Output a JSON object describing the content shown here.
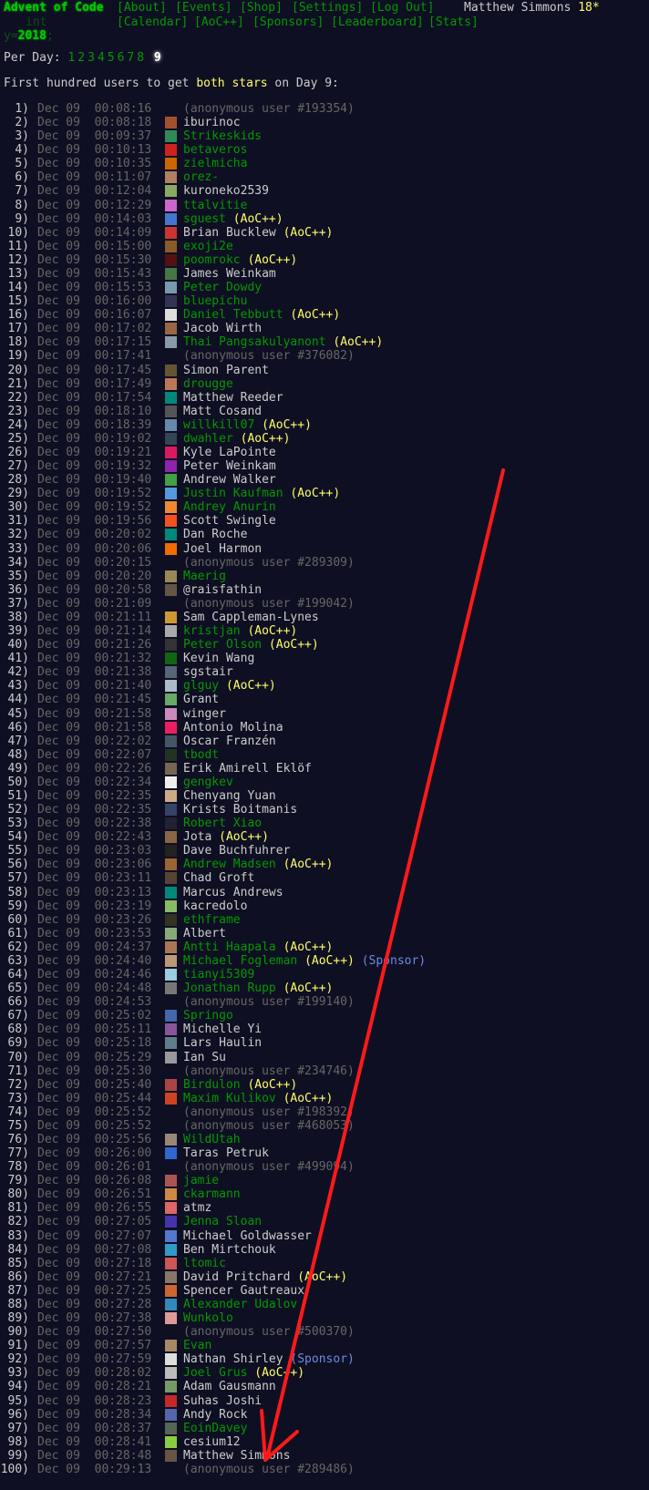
{
  "header": {
    "title": "Advent of Code",
    "year_prefix": "int y=",
    "year_value": "2018",
    "year_suffix": ";",
    "nav": [
      "[About]",
      "[Events]",
      "[Shop]",
      "[Settings]",
      "[Log Out]"
    ],
    "nav2": [
      "[Calendar]",
      "[AoC++]",
      "[Sponsors]",
      "[Leaderboard]",
      "[Stats]"
    ],
    "user": "Matthew Simmons",
    "stars": "18*"
  },
  "per_day": {
    "label": "Per Day:",
    "days": [
      "1",
      "2",
      "3",
      "4",
      "5",
      "6",
      "7",
      "8"
    ],
    "current": "9"
  },
  "intro": {
    "before": "First hundred users to get ",
    "highlight": "both stars",
    "after": " on Day 9:"
  },
  "entries": [
    {
      "rank": "1)",
      "time": "Dec 09  00:08:16",
      "name": "(anonymous user #193354)",
      "style": "anon",
      "avatar": "none"
    },
    {
      "rank": "2)",
      "time": "Dec 09  00:08:18",
      "name": "iburinoc",
      "style": "plain",
      "avatar": "#a0522d"
    },
    {
      "rank": "3)",
      "time": "Dec 09  00:09:37",
      "name": "Strikeskids",
      "style": "linked",
      "avatar": "#2e8b57"
    },
    {
      "rank": "4)",
      "time": "Dec 09  00:10:13",
      "name": "betaveros",
      "style": "linked",
      "avatar": "#cc2222"
    },
    {
      "rank": "5)",
      "time": "Dec 09  00:10:35",
      "name": "zielmicha",
      "style": "linked",
      "avatar": "#cc6600"
    },
    {
      "rank": "6)",
      "time": "Dec 09  00:11:07",
      "name": "orez-",
      "style": "linked",
      "avatar": "#b08060"
    },
    {
      "rank": "7)",
      "time": "Dec 09  00:12:04",
      "name": "kuroneko2539",
      "style": "plain",
      "avatar": "#88aa66"
    },
    {
      "rank": "8)",
      "time": "Dec 09  00:12:29",
      "name": "ttalvitie",
      "style": "linked",
      "avatar": "#cc66cc"
    },
    {
      "rank": "9)",
      "time": "Dec 09  00:14:03",
      "name": "sguest",
      "style": "linked",
      "aoc": "(AoC++)",
      "avatar": "#4477cc"
    },
    {
      "rank": "10)",
      "time": "Dec 09  00:14:09",
      "name": "Brian Bucklew",
      "style": "plain",
      "aoc": "(AoC++)",
      "avatar": "#cc3333"
    },
    {
      "rank": "11)",
      "time": "Dec 09  00:15:00",
      "name": "exoji2e",
      "style": "linked",
      "avatar": "#8b5a2b"
    },
    {
      "rank": "12)",
      "time": "Dec 09  00:15:30",
      "name": "poomrokc",
      "style": "linked",
      "aoc": "(AoC++)",
      "avatar": "#551111"
    },
    {
      "rank": "13)",
      "time": "Dec 09  00:15:43",
      "name": "James Weinkam",
      "style": "plain",
      "avatar": "#447744"
    },
    {
      "rank": "14)",
      "time": "Dec 09  00:15:53",
      "name": "Peter Dowdy",
      "style": "linked",
      "avatar": "#7799aa"
    },
    {
      "rank": "15)",
      "time": "Dec 09  00:16:00",
      "name": "bluepichu",
      "style": "linked",
      "avatar": "#333355"
    },
    {
      "rank": "16)",
      "time": "Dec 09  00:16:07",
      "name": "Daniel Tebbutt",
      "style": "linked",
      "aoc": "(AoC++)",
      "avatar": "#dddddd"
    },
    {
      "rank": "17)",
      "time": "Dec 09  00:17:02",
      "name": "Jacob Wirth",
      "style": "plain",
      "avatar": "#996644"
    },
    {
      "rank": "18)",
      "time": "Dec 09  00:17:15",
      "name": "Thai Pangsakulyanont",
      "style": "linked",
      "aoc": "(AoC++)",
      "avatar": "#8899aa"
    },
    {
      "rank": "19)",
      "time": "Dec 09  00:17:41",
      "name": "(anonymous user #376082)",
      "style": "anon",
      "avatar": "none"
    },
    {
      "rank": "20)",
      "time": "Dec 09  00:17:45",
      "name": "Simon Parent",
      "style": "plain",
      "avatar": "#665533"
    },
    {
      "rank": "21)",
      "time": "Dec 09  00:17:49",
      "name": "drougge",
      "style": "linked",
      "avatar": "#bb7755"
    },
    {
      "rank": "22)",
      "time": "Dec 09  00:17:54",
      "name": "Matthew Reeder",
      "style": "plain",
      "avatar": "#00897b"
    },
    {
      "rank": "23)",
      "time": "Dec 09  00:18:10",
      "name": "Matt Cosand",
      "style": "plain",
      "avatar": "#555555"
    },
    {
      "rank": "24)",
      "time": "Dec 09  00:18:39",
      "name": "willkill07",
      "style": "linked",
      "aoc": "(AoC++)",
      "avatar": "#6688aa"
    },
    {
      "rank": "25)",
      "time": "Dec 09  00:19:02",
      "name": "dwahler",
      "style": "linked",
      "aoc": "(AoC++)",
      "avatar": "#334455"
    },
    {
      "rank": "26)",
      "time": "Dec 09  00:19:21",
      "name": "Kyle LaPointe",
      "style": "plain",
      "avatar": "#d81b60"
    },
    {
      "rank": "27)",
      "time": "Dec 09  00:19:32",
      "name": "Peter Weinkam",
      "style": "plain",
      "avatar": "#8e24aa"
    },
    {
      "rank": "28)",
      "time": "Dec 09  00:19:40",
      "name": "Andrew Walker",
      "style": "plain",
      "avatar": "#43a047"
    },
    {
      "rank": "29)",
      "time": "Dec 09  00:19:52",
      "name": "Justin Kaufman",
      "style": "linked",
      "aoc": "(AoC++)",
      "avatar": "#5599dd"
    },
    {
      "rank": "30)",
      "time": "Dec 09  00:19:52",
      "name": "Andrey Anurin",
      "style": "linked",
      "avatar": "#ee8833"
    },
    {
      "rank": "31)",
      "time": "Dec 09  00:19:56",
      "name": "Scott Swingle",
      "style": "plain",
      "avatar": "#f4511e"
    },
    {
      "rank": "32)",
      "time": "Dec 09  00:20:02",
      "name": "Dan Roche",
      "style": "plain",
      "avatar": "#00897b"
    },
    {
      "rank": "33)",
      "time": "Dec 09  00:20:06",
      "name": "Joel Harmon",
      "style": "plain",
      "avatar": "#ef6c00"
    },
    {
      "rank": "34)",
      "time": "Dec 09  00:20:15",
      "name": "(anonymous user #289309)",
      "style": "anon",
      "avatar": "none"
    },
    {
      "rank": "35)",
      "time": "Dec 09  00:20:20",
      "name": "Maerig",
      "style": "linked",
      "avatar": "#998855"
    },
    {
      "rank": "36)",
      "time": "Dec 09  00:20:58",
      "name": "@raisfathin",
      "style": "plain",
      "avatar": "#665544"
    },
    {
      "rank": "37)",
      "time": "Dec 09  00:21:09",
      "name": "(anonymous user #199042)",
      "style": "anon",
      "avatar": "none"
    },
    {
      "rank": "38)",
      "time": "Dec 09  00:21:11",
      "name": "Sam Cappleman-Lynes",
      "style": "plain",
      "avatar": "#cc9933"
    },
    {
      "rank": "39)",
      "time": "Dec 09  00:21:14",
      "name": "kristjan",
      "style": "linked",
      "aoc": "(AoC++)",
      "avatar": "#aaaaaa"
    },
    {
      "rank": "40)",
      "time": "Dec 09  00:21:26",
      "name": "Peter Olson",
      "style": "linked",
      "aoc": "(AoC++)",
      "avatar": "#333333"
    },
    {
      "rank": "41)",
      "time": "Dec 09  00:21:32",
      "name": "Kevin Wang",
      "style": "plain",
      "avatar": "#116611"
    },
    {
      "rank": "42)",
      "time": "Dec 09  00:21:38",
      "name": "sgstair",
      "style": "plain",
      "avatar": "#556677"
    },
    {
      "rank": "43)",
      "time": "Dec 09  00:21:40",
      "name": "glguy",
      "style": "linked",
      "aoc": "(AoC++)",
      "avatar": "#aabbcc"
    },
    {
      "rank": "44)",
      "time": "Dec 09  00:21:45",
      "name": "Grant",
      "style": "plain",
      "avatar": "#66aa66"
    },
    {
      "rank": "45)",
      "time": "Dec 09  00:21:58",
      "name": "winger",
      "style": "plain",
      "avatar": "#cc88bb"
    },
    {
      "rank": "46)",
      "time": "Dec 09  00:21:58",
      "name": "Antonio Molina",
      "style": "plain",
      "avatar": "#e91e63"
    },
    {
      "rank": "47)",
      "time": "Dec 09  00:22:02",
      "name": "Oscar Franzén",
      "style": "plain",
      "avatar": "#445566"
    },
    {
      "rank": "48)",
      "time": "Dec 09  00:22:07",
      "name": "tbodt",
      "style": "linked",
      "avatar": "#223322"
    },
    {
      "rank": "49)",
      "time": "Dec 09  00:22:26",
      "name": "Erik Amirell Eklöf",
      "style": "plain",
      "avatar": "#776655"
    },
    {
      "rank": "50)",
      "time": "Dec 09  00:22:34",
      "name": "gengkev",
      "style": "linked",
      "avatar": "#eeeeee"
    },
    {
      "rank": "51)",
      "time": "Dec 09  00:22:35",
      "name": "Chenyang Yuan",
      "style": "plain",
      "avatar": "#ccaa88"
    },
    {
      "rank": "52)",
      "time": "Dec 09  00:22:35",
      "name": "Krists Boitmanis",
      "style": "plain",
      "avatar": "#334466"
    },
    {
      "rank": "53)",
      "time": "Dec 09  00:22:38",
      "name": "Robert Xiao",
      "style": "linked",
      "avatar": "#222233"
    },
    {
      "rank": "54)",
      "time": "Dec 09  00:22:43",
      "name": "Jota",
      "style": "plain",
      "aoc": "(AoC++)",
      "avatar": "#886644"
    },
    {
      "rank": "55)",
      "time": "Dec 09  00:23:03",
      "name": "Dave Buchfuhrer",
      "style": "plain",
      "avatar": "#222222"
    },
    {
      "rank": "56)",
      "time": "Dec 09  00:23:06",
      "name": "Andrew Madsen",
      "style": "linked",
      "aoc": "(AoC++)",
      "avatar": "#996633"
    },
    {
      "rank": "57)",
      "time": "Dec 09  00:23:11",
      "name": "Chad Groft",
      "style": "plain",
      "avatar": "#554433"
    },
    {
      "rank": "58)",
      "time": "Dec 09  00:23:13",
      "name": "Marcus Andrews",
      "style": "plain",
      "avatar": "#00897b"
    },
    {
      "rank": "59)",
      "time": "Dec 09  00:23:19",
      "name": "kacredolo",
      "style": "plain",
      "avatar": "#88bb66"
    },
    {
      "rank": "60)",
      "time": "Dec 09  00:23:26",
      "name": "ethframe",
      "style": "linked",
      "avatar": "#333322"
    },
    {
      "rank": "61)",
      "time": "Dec 09  00:23:53",
      "name": "Albert",
      "style": "plain",
      "avatar": "#88aa77"
    },
    {
      "rank": "62)",
      "time": "Dec 09  00:24:37",
      "name": "Antti Haapala",
      "style": "linked",
      "aoc": "(AoC++)",
      "avatar": "#aa7755"
    },
    {
      "rank": "63)",
      "time": "Dec 09  00:24:40",
      "name": "Michael Fogleman",
      "style": "linked",
      "aoc": "(AoC++)",
      "sponsor": "(Sponsor)",
      "avatar": "#bb9977"
    },
    {
      "rank": "64)",
      "time": "Dec 09  00:24:46",
      "name": "tianyi5309",
      "style": "linked",
      "avatar": "#99ccdd"
    },
    {
      "rank": "65)",
      "time": "Dec 09  00:24:48",
      "name": "Jonathan Rupp",
      "style": "linked",
      "aoc": "(AoC++)",
      "avatar": "#777777"
    },
    {
      "rank": "66)",
      "time": "Dec 09  00:24:53",
      "name": "(anonymous user #199140)",
      "style": "anon",
      "avatar": "none"
    },
    {
      "rank": "67)",
      "time": "Dec 09  00:25:02",
      "name": "Springo",
      "style": "linked",
      "avatar": "#4466aa"
    },
    {
      "rank": "68)",
      "time": "Dec 09  00:25:11",
      "name": "Michelle Yi",
      "style": "plain",
      "avatar": "#885599"
    },
    {
      "rank": "69)",
      "time": "Dec 09  00:25:18",
      "name": "Lars Haulin",
      "style": "plain",
      "avatar": "#607d8b"
    },
    {
      "rank": "70)",
      "time": "Dec 09  00:25:29",
      "name": "Ian Su",
      "style": "plain",
      "avatar": "#999999"
    },
    {
      "rank": "71)",
      "time": "Dec 09  00:25:30",
      "name": "(anonymous user #234746)",
      "style": "anon",
      "avatar": "none"
    },
    {
      "rank": "72)",
      "time": "Dec 09  00:25:40",
      "name": "Birdulon",
      "style": "linked",
      "aoc": "(AoC++)",
      "avatar": "#aa4444"
    },
    {
      "rank": "73)",
      "time": "Dec 09  00:25:44",
      "name": "Maxim Kulikov",
      "style": "linked",
      "aoc": "(AoC++)",
      "avatar": "#cc4422"
    },
    {
      "rank": "74)",
      "time": "Dec 09  00:25:52",
      "name": "(anonymous user #198392)",
      "style": "anon",
      "avatar": "none"
    },
    {
      "rank": "75)",
      "time": "Dec 09  00:25:52",
      "name": "(anonymous user #468053)",
      "style": "anon",
      "avatar": "none"
    },
    {
      "rank": "76)",
      "time": "Dec 09  00:25:56",
      "name": "WildUtah",
      "style": "linked",
      "avatar": "#998877"
    },
    {
      "rank": "77)",
      "time": "Dec 09  00:26:00",
      "name": "Taras Petruk",
      "style": "plain",
      "avatar": "#3366cc"
    },
    {
      "rank": "78)",
      "time": "Dec 09  00:26:01",
      "name": "(anonymous user #499094)",
      "style": "anon",
      "avatar": "none"
    },
    {
      "rank": "79)",
      "time": "Dec 09  00:26:08",
      "name": "jamie",
      "style": "linked",
      "avatar": "#aa5555"
    },
    {
      "rank": "80)",
      "time": "Dec 09  00:26:51",
      "name": "ckarmann",
      "style": "linked",
      "avatar": "#cc8844"
    },
    {
      "rank": "81)",
      "time": "Dec 09  00:26:55",
      "name": "atmz",
      "style": "plain",
      "avatar": "#dd6666"
    },
    {
      "rank": "82)",
      "time": "Dec 09  00:27:05",
      "name": "Jenna Sloan",
      "style": "linked",
      "avatar": "#4433aa"
    },
    {
      "rank": "83)",
      "time": "Dec 09  00:27:07",
      "name": "Michael Goldwasser",
      "style": "plain",
      "avatar": "#5577cc"
    },
    {
      "rank": "84)",
      "time": "Dec 09  00:27:08",
      "name": "Ben Mirtchouk",
      "style": "plain",
      "avatar": "#3399cc"
    },
    {
      "rank": "85)",
      "time": "Dec 09  00:27:18",
      "name": "ltomic",
      "style": "linked",
      "avatar": "#cc5555"
    },
    {
      "rank": "86)",
      "time": "Dec 09  00:27:21",
      "name": "David Pritchard",
      "style": "plain",
      "aoc": "(AoC++)",
      "avatar": "#887766"
    },
    {
      "rank": "87)",
      "time": "Dec 09  00:27:25",
      "name": "Spencer Gautreaux",
      "style": "plain",
      "avatar": "#cc6633"
    },
    {
      "rank": "88)",
      "time": "Dec 09  00:27:28",
      "name": "Alexander Udalov",
      "style": "linked",
      "avatar": "#3388bb"
    },
    {
      "rank": "89)",
      "time": "Dec 09  00:27:38",
      "name": "Wunkolo",
      "style": "linked",
      "avatar": "#dd9999"
    },
    {
      "rank": "90)",
      "time": "Dec 09  00:27:50",
      "name": "(anonymous user #500370)",
      "style": "anon",
      "avatar": "none"
    },
    {
      "rank": "91)",
      "time": "Dec 09  00:27:57",
      "name": "Evan",
      "style": "linked",
      "avatar": "#aa8866"
    },
    {
      "rank": "92)",
      "time": "Dec 09  00:27:59",
      "name": "Nathan Shirley",
      "style": "plain",
      "sponsor": "(Sponsor)",
      "avatar": "#dddddd"
    },
    {
      "rank": "93)",
      "time": "Dec 09  00:28:02",
      "name": "Joel Grus",
      "style": "linked",
      "aoc": "(AoC++)",
      "avatar": "#bbbbbb"
    },
    {
      "rank": "94)",
      "time": "Dec 09  00:28:21",
      "name": "Adam Gausmann",
      "style": "plain",
      "avatar": "#779966"
    },
    {
      "rank": "95)",
      "time": "Dec 09  00:28:23",
      "name": "Suhas Joshi",
      "style": "plain",
      "avatar": "#c62828"
    },
    {
      "rank": "96)",
      "time": "Dec 09  00:28:34",
      "name": "Andy Rock",
      "style": "plain",
      "avatar": "#5566aa"
    },
    {
      "rank": "97)",
      "time": "Dec 09  00:28:37",
      "name": "EoinDavey",
      "style": "linked",
      "avatar": "#556655"
    },
    {
      "rank": "98)",
      "time": "Dec 09  00:28:41",
      "name": "cesium12",
      "style": "plain",
      "avatar": "#88cc44"
    },
    {
      "rank": "99)",
      "time": "Dec 09  00:28:48",
      "name": "Matthew Simmons",
      "style": "plain",
      "avatar": "#665544"
    },
    {
      "rank": "100)",
      "time": "Dec 09  00:29:13",
      "name": "(anonymous user #289486)",
      "style": "anon",
      "avatar": "none"
    }
  ],
  "annotation": {
    "arrow_color": "#ff1a1a"
  }
}
